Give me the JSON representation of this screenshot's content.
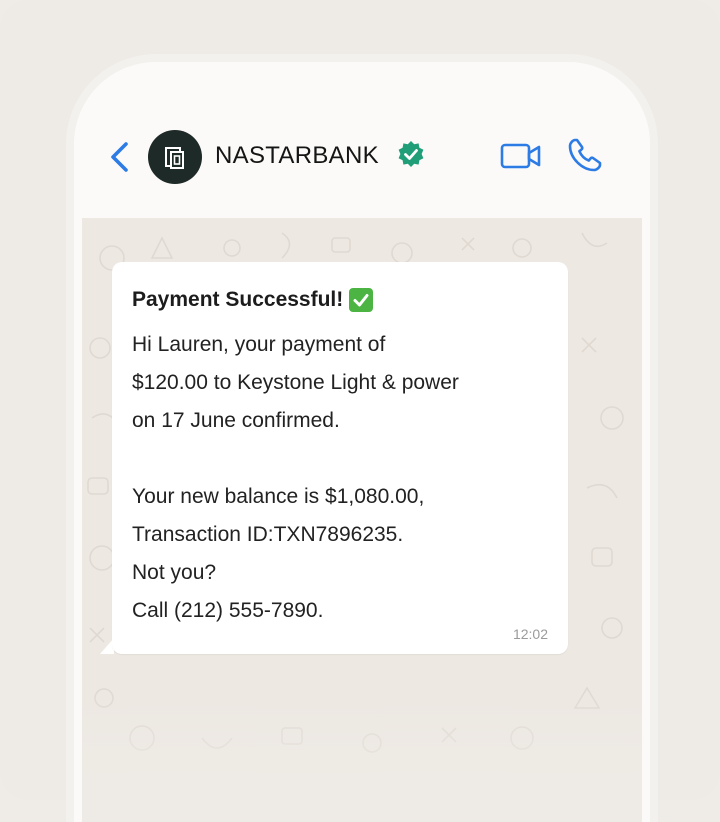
{
  "header": {
    "contact_name": "NASTARBANK",
    "icons": {
      "back": "chevron-left-icon",
      "avatar": "bank-logo-icon",
      "verified": "verified-badge-icon",
      "video": "video-camera-icon",
      "call": "phone-icon"
    },
    "accent_color": "#2d7be5",
    "verified_color": "#1f9e78"
  },
  "message": {
    "title": "Payment Successful!",
    "title_emoji": "check-mark-button-icon",
    "lines": [
      "Hi Lauren,  your payment of",
      "$120.00 to Keystone Light & power",
      "on 17 June confirmed.",
      "",
      "Your new balance is $1,080.00,",
      "Transaction ID:TXN7896235.",
      "Not you?",
      "Call (212) 555-7890."
    ],
    "time": "12:02"
  }
}
